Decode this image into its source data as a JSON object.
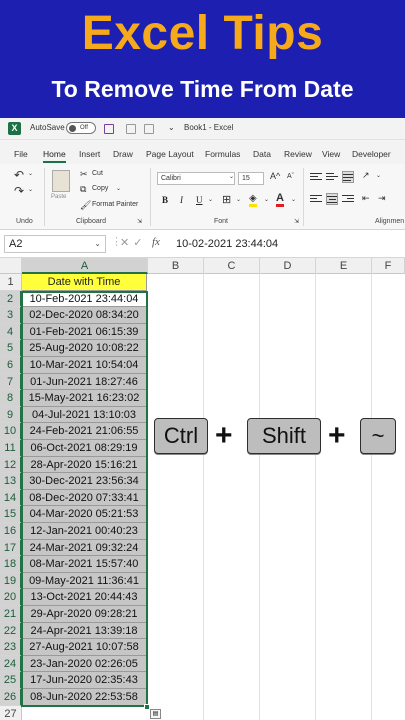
{
  "banner": {
    "title": "Excel Tips",
    "subtitle": "To Remove Time From Date"
  },
  "titlebar": {
    "logo": "X",
    "autosave_label": "AutoSave",
    "toggle_state": "Off",
    "book_title": "Book1  -  Excel"
  },
  "tabs": [
    "File",
    "Home",
    "Insert",
    "Draw",
    "Page Layout",
    "Formulas",
    "Data",
    "Review",
    "View",
    "Developer"
  ],
  "active_tab": "Home",
  "ribbon": {
    "undo_label": "Undo",
    "paste_label": "Paste",
    "cut_label": "Cut",
    "copy_label": "Copy",
    "format_painter_label": "Format Painter",
    "clipboard_label": "Clipboard",
    "font_name": "Calibri",
    "font_size": "15",
    "font_label": "Font",
    "alignment_label": "Alignmen",
    "bold": "B",
    "italic": "I",
    "underline": "U"
  },
  "formula_bar": {
    "name_box": "A2",
    "value": "10-02-2021  23:44:04",
    "fx": "fx"
  },
  "columns": [
    "A",
    "B",
    "C",
    "D",
    "E",
    "F"
  ],
  "selected_column": "A",
  "sheet": {
    "header": "Date with Time",
    "rows": [
      "10-Feb-2021 23:44:04",
      "02-Dec-2020 08:34:20",
      "01-Feb-2021 06:15:39",
      "25-Aug-2020 10:08:22",
      "10-Mar-2021 10:54:04",
      "01-Jun-2021 18:27:46",
      "15-May-2021 16:23:02",
      "04-Jul-2021 13:10:03",
      "24-Feb-2021 21:06:55",
      "06-Oct-2021 08:29:19",
      "28-Apr-2020 15:16:21",
      "30-Dec-2021 23:56:34",
      "08-Dec-2020 07:33:41",
      "04-Mar-2020 05:21:53",
      "12-Jan-2021 00:40:23",
      "24-Mar-2021 09:32:24",
      "08-Mar-2021 15:57:40",
      "09-May-2021 11:36:41",
      "13-Oct-2021 20:44:43",
      "29-Apr-2020 09:28:21",
      "24-Apr-2021 13:39:18",
      "27-Aug-2021 10:07:58",
      "23-Jan-2020 02:26:05",
      "17-Jun-2020 02:35:43",
      "08-Jun-2020 22:53:58"
    ],
    "row_numbers": [
      "1",
      "2",
      "3",
      "4",
      "5",
      "6",
      "7",
      "8",
      "9",
      "10",
      "11",
      "12",
      "13",
      "14",
      "15",
      "16",
      "17",
      "18",
      "19",
      "20",
      "21",
      "22",
      "23",
      "24",
      "25",
      "26",
      "27"
    ]
  },
  "shortcut": {
    "keys": [
      "Ctrl",
      "Shift",
      "~"
    ],
    "plus": "+"
  }
}
